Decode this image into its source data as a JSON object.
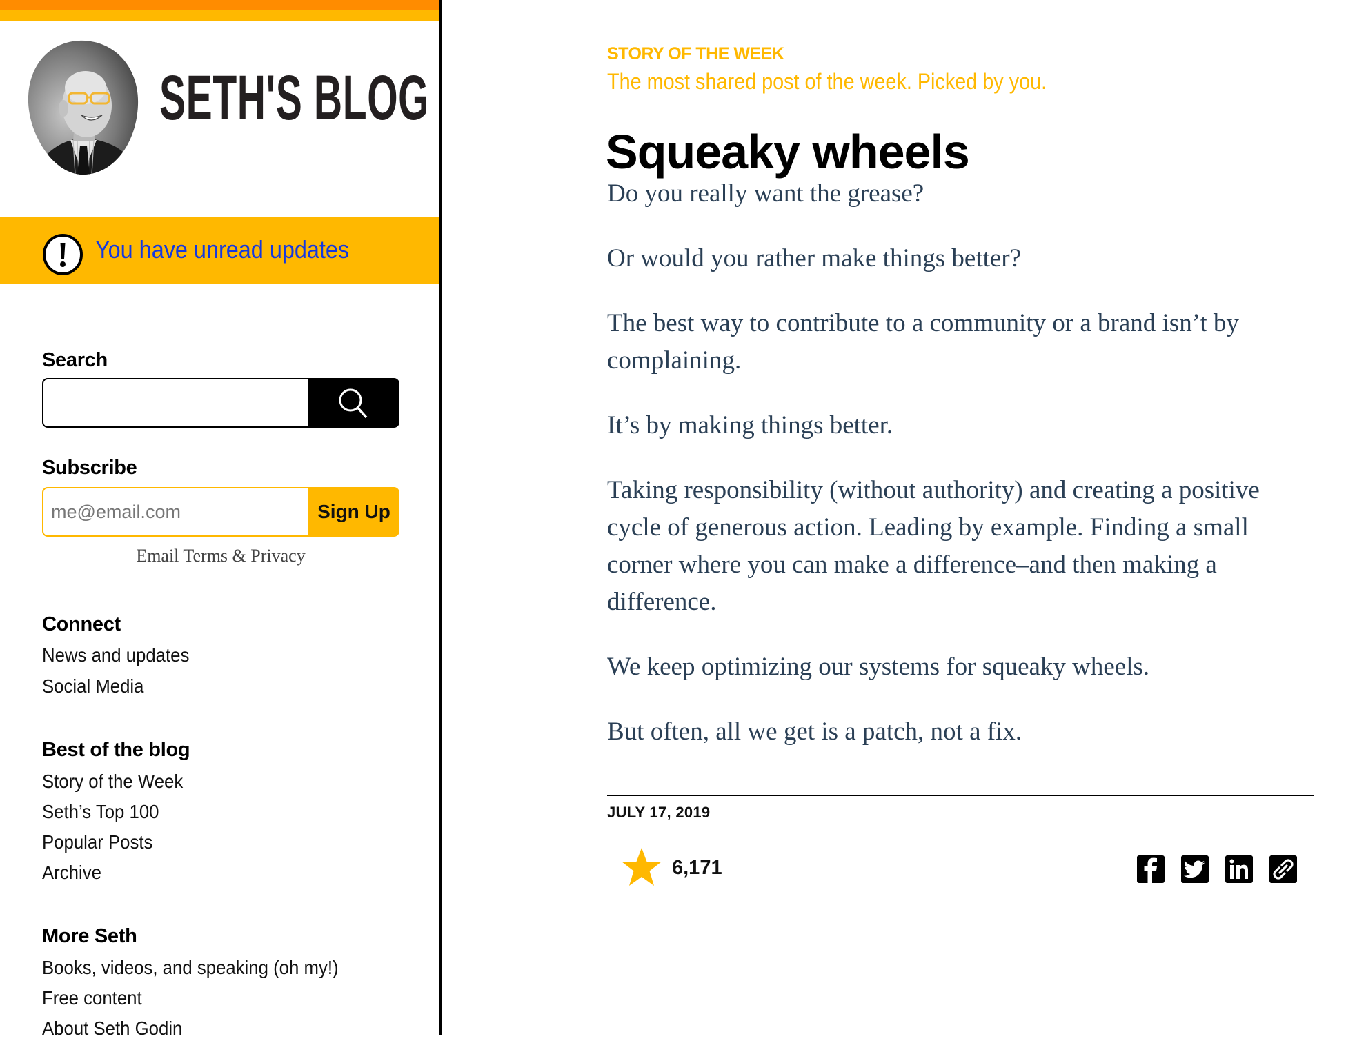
{
  "site": {
    "title": "SETH'S BLOG",
    "colors": {
      "orange_bar": "#FF8C00",
      "accent_yellow": "#FFB800",
      "link_blue": "#1438e0",
      "body_text": "#2a3f55"
    }
  },
  "sidebar": {
    "updates_banner": {
      "icon": "alert-circle-icon",
      "text": "You have unread updates"
    },
    "search": {
      "heading": "Search",
      "input_value": "",
      "input_placeholder": "",
      "button_icon": "search-icon"
    },
    "subscribe": {
      "heading": "Subscribe",
      "email_value": "",
      "email_placeholder": "me@email.com",
      "button_label": "Sign Up",
      "terms_link": "Email Terms & Privacy"
    },
    "sections": [
      {
        "heading": "Connect",
        "items": [
          "News and updates",
          "Social Media"
        ]
      },
      {
        "heading": "Best of the blog",
        "items": [
          "Story of the Week",
          "Seth’s Top 100",
          "Popular Posts",
          "Archive"
        ]
      },
      {
        "heading": "More Seth",
        "items": [
          "Books, videos, and speaking (oh my!)",
          "Free content",
          "About Seth Godin"
        ]
      }
    ]
  },
  "main": {
    "kicker": "STORY OF THE WEEK",
    "kicker_sub": "The most shared post of the week. Picked by you.",
    "post": {
      "title": "Squeaky wheels",
      "paragraphs": [
        "Do you really want the grease?",
        "Or would you rather make things better?",
        "The best way to contribute to a community or a brand isn’t by complaining.",
        "It’s by making things better.",
        "Taking responsibility (without authority) and creating a positive cycle of generous action. Leading by example. Finding a small corner where you can make a difference–and then making a difference.",
        "We keep optimizing our systems for squeaky wheels.",
        "But often, all we get is a patch, not a fix."
      ],
      "date": "JULY 17, 2019",
      "star_icon": "star-icon",
      "star_count": "6,171",
      "share": [
        {
          "name": "facebook",
          "icon": "facebook-icon"
        },
        {
          "name": "twitter",
          "icon": "twitter-icon"
        },
        {
          "name": "linkedin",
          "icon": "linkedin-icon"
        },
        {
          "name": "copy-link",
          "icon": "link-icon"
        }
      ]
    }
  }
}
